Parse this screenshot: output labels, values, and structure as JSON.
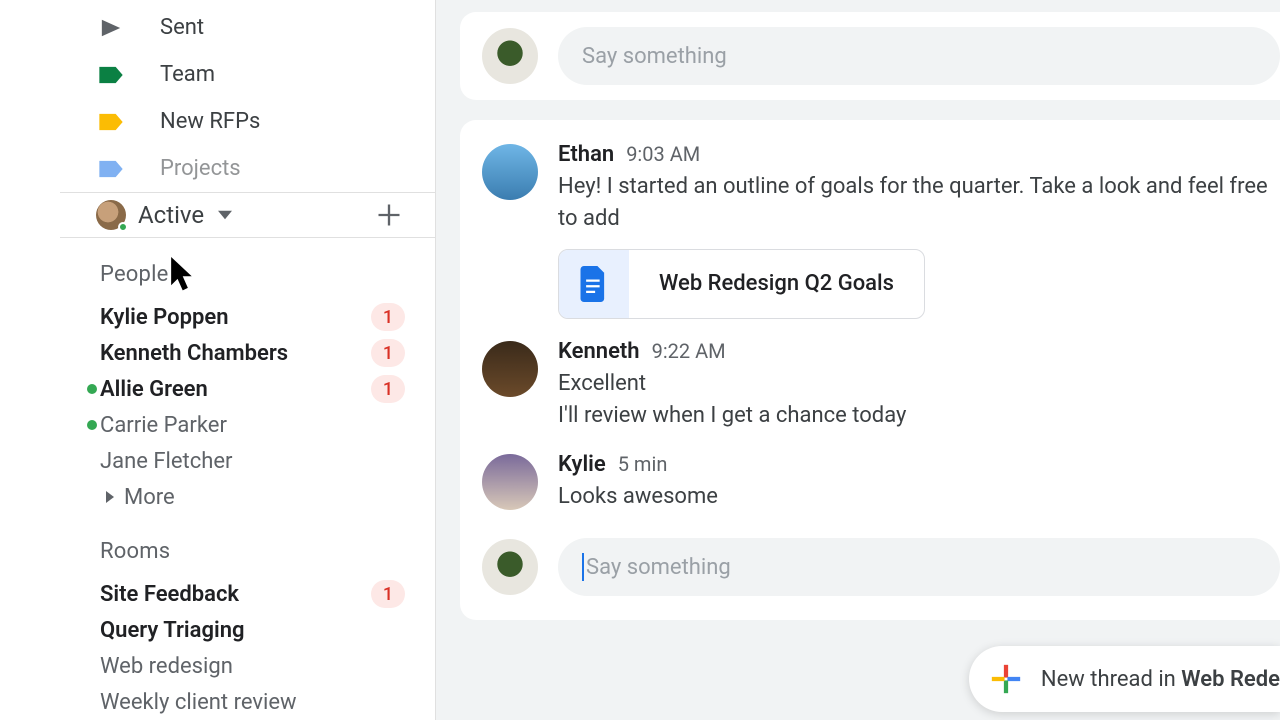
{
  "sidebar": {
    "nav": [
      {
        "label": "Sent",
        "icon": "sent"
      },
      {
        "label": "Team",
        "icon": "tag-green"
      },
      {
        "label": "New RFPs",
        "icon": "tag-yellow"
      },
      {
        "label": "Projects",
        "icon": "tag-blue"
      }
    ],
    "presence": {
      "status": "Active"
    },
    "people_header": "People",
    "people": [
      {
        "name": "Kylie Poppen",
        "unread": 1,
        "online": false
      },
      {
        "name": "Kenneth Chambers",
        "unread": 1,
        "online": false
      },
      {
        "name": "Allie Green",
        "unread": 1,
        "online": true
      },
      {
        "name": "Carrie Parker",
        "unread": 0,
        "online": true
      },
      {
        "name": "Jane Fletcher",
        "unread": 0,
        "online": false
      }
    ],
    "more_label": "More",
    "rooms_header": "Rooms",
    "rooms": [
      {
        "name": "Site Feedback",
        "unread": 1
      },
      {
        "name": "Query Triaging",
        "unread": 0,
        "bold": true
      },
      {
        "name": "Web redesign",
        "unread": 0
      },
      {
        "name": "Weekly client review",
        "unread": 0
      }
    ]
  },
  "compose": {
    "placeholder": "Say something"
  },
  "thread": {
    "messages": [
      {
        "author": "Ethan",
        "time": "9:03 AM",
        "text": "Hey! I started an outline of goals for the quarter. Take a look and feel free to add",
        "attachment": {
          "title": "Web Redesign Q2 Goals",
          "type": "doc"
        }
      },
      {
        "author": "Kenneth",
        "time": "9:22 AM",
        "lines": [
          "Excellent",
          "I'll review when I get a chance today"
        ]
      },
      {
        "author": "Kylie",
        "time": "5 min",
        "text": "Looks awesome"
      }
    ],
    "reply_placeholder": "Say something"
  },
  "fab": {
    "prefix": "New thread in ",
    "room": "Web Rede"
  }
}
